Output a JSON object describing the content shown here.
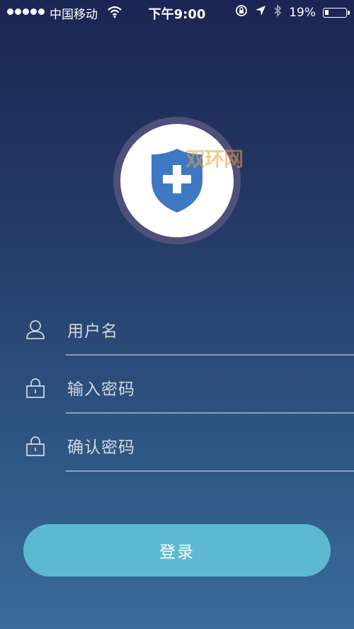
{
  "status_bar": {
    "carrier": "中国移动",
    "time": "下午9:00",
    "battery_percent": "19%",
    "battery_level": 0.19
  },
  "logo": {
    "watermark": "双环网",
    "shield_color": "#3e78c2"
  },
  "form": {
    "username_placeholder": "用户名",
    "password_placeholder": "输入密码",
    "confirm_placeholder": "确认密码"
  },
  "login_button_label": "登录",
  "colors": {
    "accent": "#5db9d1",
    "ring": "#4f4f7c"
  }
}
